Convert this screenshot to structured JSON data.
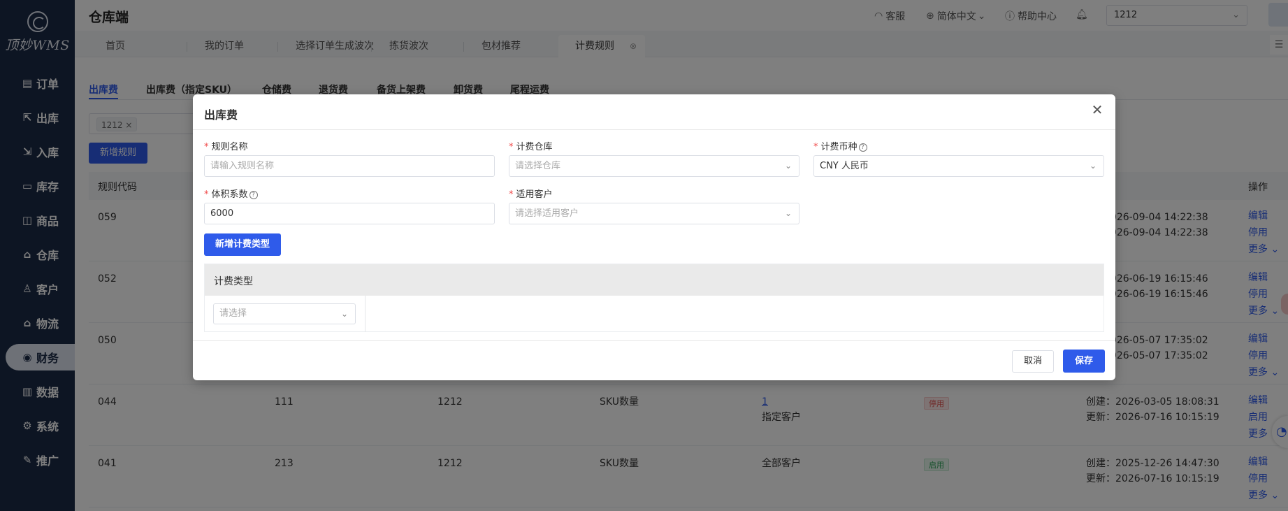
{
  "app": {
    "logo_text": "顶妙WMS",
    "title": "仓库端",
    "header": {
      "service": "客服",
      "language": "简体中文",
      "help": "帮助中心",
      "warehouse_select": "1212"
    }
  },
  "sidebar": {
    "items": [
      {
        "label": "订单",
        "icon": "▤"
      },
      {
        "label": "出库",
        "icon": "⇱"
      },
      {
        "label": "入库",
        "icon": "⇲"
      },
      {
        "label": "库存",
        "icon": "▭"
      },
      {
        "label": "商品",
        "icon": "◫"
      },
      {
        "label": "仓库",
        "icon": "⌂"
      },
      {
        "label": "客户",
        "icon": "♙"
      },
      {
        "label": "物流",
        "icon": "⌂"
      },
      {
        "label": "财务",
        "icon": "◉"
      },
      {
        "label": "数据",
        "icon": "▥"
      },
      {
        "label": "系统",
        "icon": "⚙"
      },
      {
        "label": "推广",
        "icon": "✎"
      }
    ],
    "active": "财务"
  },
  "tabs": [
    "首页",
    "我的订单",
    "选择订单生成波次",
    "拣货波次",
    "包材推荐",
    "计费规则"
  ],
  "subtabs": [
    "出库费",
    "出库费（指定SKU）",
    "仓储费",
    "退货费",
    "备货上架费",
    "卸货费",
    "尾程运费"
  ],
  "filter": {
    "tag": "1212"
  },
  "buttons": {
    "add_rule": "新增规则"
  },
  "table": {
    "headers": {
      "code": "规则代码",
      "ops": "操作"
    },
    "rows": [
      {
        "code": "059",
        "name": "",
        "warehouse": "",
        "type": "",
        "customer": "",
        "status": "",
        "created": "2026-09-04 14:22:38",
        "updated": "2026-09-04 14:22:38",
        "op1": "编辑",
        "op2": "停用",
        "more": "更多"
      },
      {
        "code": "052",
        "name": "",
        "warehouse": "",
        "type": "",
        "customer": "",
        "status": "",
        "created": "2026-06-19 16:15:46",
        "updated": "2026-06-19 16:15:46",
        "op1": "编辑",
        "op2": "停用",
        "more": "更多"
      },
      {
        "code": "050",
        "name": "",
        "warehouse": "",
        "type": "",
        "customer": "",
        "status": "",
        "created": "2026-05-07 17:35:02",
        "updated": "2026-05-07 17:35:02",
        "op1": "编辑",
        "op2": "停用",
        "more": "更多"
      },
      {
        "code": "044",
        "name": "111",
        "warehouse": "1212",
        "type": "SKU数量",
        "customer_link": "1",
        "customer": "指定客户",
        "status": "停用",
        "created": "创建：2026-03-05 18:08:31",
        "updated": "更新：2026-07-16 10:15:19",
        "op1": "编辑",
        "op2": "启用",
        "more": "更多"
      },
      {
        "code": "041",
        "name": "213",
        "warehouse": "1212",
        "type": "SKU数量",
        "customer": "全部客户",
        "status": "启用",
        "created": "创建：2025-12-26 14:47:30",
        "updated": "更新：2026-07-16 10:15:19",
        "op1": "编辑",
        "op2": "停用",
        "more": "更多"
      }
    ]
  },
  "modal": {
    "title": "出库费",
    "fields": {
      "rule_name": {
        "label": "规则名称",
        "placeholder": "请输入规则名称"
      },
      "warehouse": {
        "label": "计费仓库",
        "placeholder": "请选择仓库"
      },
      "currency": {
        "label": "计费币种",
        "value": "CNY 人民币"
      },
      "volume_factor": {
        "label": "体积系数",
        "value": "6000"
      },
      "customer": {
        "label": "适用客户",
        "placeholder": "请选择适用客户"
      }
    },
    "add_fee_type": "新增计费类型",
    "fee_table": {
      "header": "计费类型",
      "select_placeholder": "请选择"
    },
    "cancel": "取消",
    "save": "保存"
  },
  "colors": {
    "primary": "#2f5bea",
    "sidebar": "#1b2a47",
    "danger": "#e0524f",
    "success": "#2aa055"
  }
}
